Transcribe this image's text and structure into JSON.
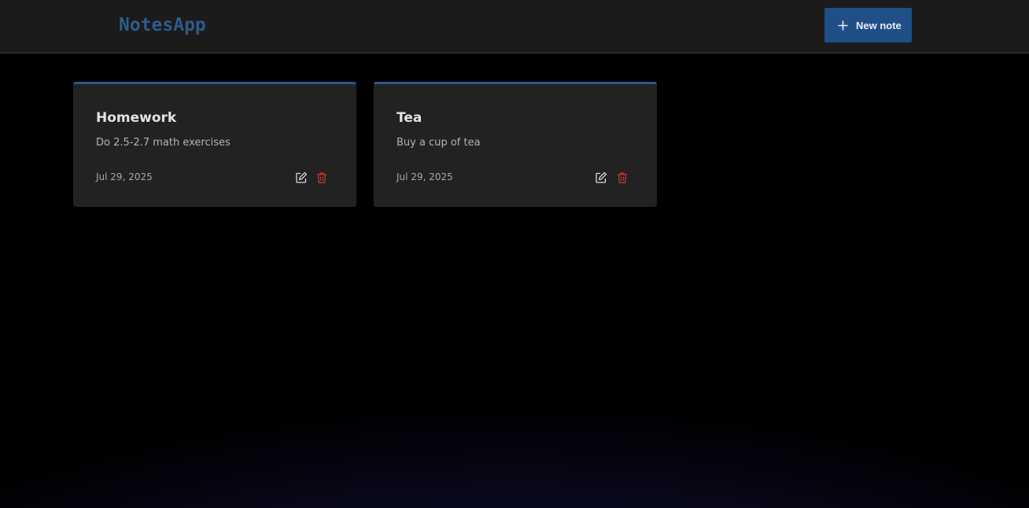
{
  "header": {
    "logo": "NotesApp",
    "new_note_button": {
      "label": "New note",
      "icon": "plus-icon"
    }
  },
  "notes": [
    {
      "title": "Homework",
      "body": "Do 2.5-2.7 math exercises",
      "date": "Jul 29, 2025",
      "actions": {
        "edit_icon": "edit-icon",
        "delete_icon": "trash-icon"
      }
    },
    {
      "title": "Tea",
      "body": "Buy a cup of tea",
      "date": "Jul 29, 2025",
      "actions": {
        "edit_icon": "edit-icon",
        "delete_icon": "trash-icon"
      }
    }
  ],
  "colors": {
    "accent": "#275a8f",
    "button_bg": "#1f4f86",
    "logo": "#2d5b8c",
    "delete": "#c0392b",
    "card_bg": "#222222",
    "header_bg": "#1b1b1b"
  }
}
